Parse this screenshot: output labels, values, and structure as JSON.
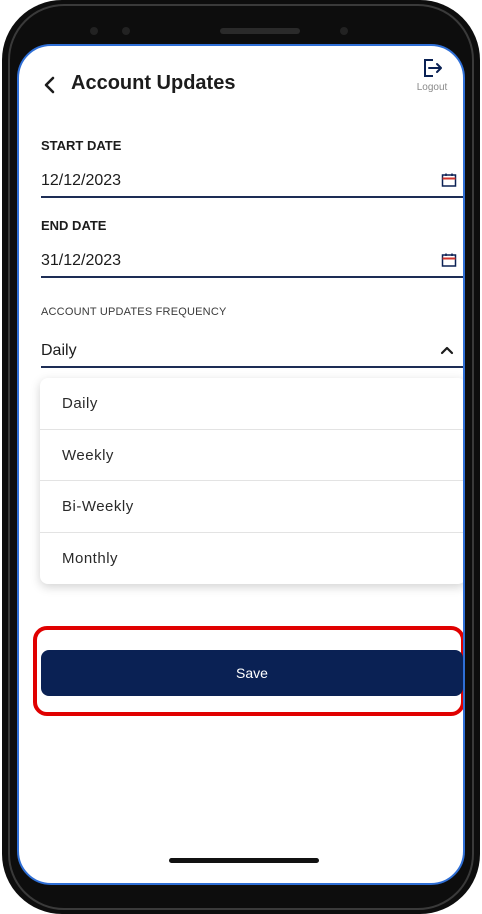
{
  "header": {
    "title": "Account Updates",
    "logout_label": "Logout"
  },
  "start_date": {
    "label": "START DATE",
    "value": "12/12/2023",
    "icon": "calendar-icon"
  },
  "end_date": {
    "label": "END DATE",
    "value": "31/12/2023",
    "icon": "calendar-icon"
  },
  "frequency": {
    "label": "ACCOUNT UPDATES FREQUENCY",
    "selected": "Daily",
    "options": [
      "Daily",
      "Weekly",
      "Bi-Weekly",
      "Monthly"
    ]
  },
  "save_label": "Save",
  "colors": {
    "primary": "#0a2154",
    "highlight": "#e00000",
    "screen_border": "#2f6fd6",
    "underline": "#1d2d55"
  }
}
